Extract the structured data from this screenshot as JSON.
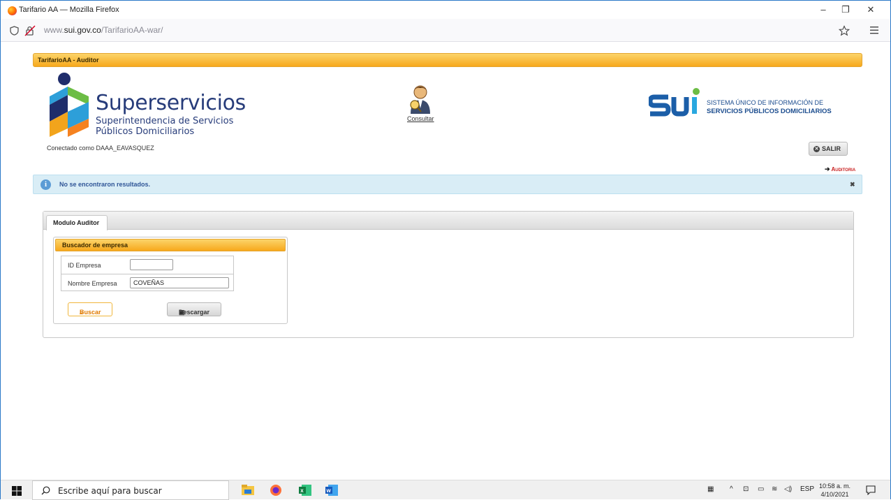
{
  "window": {
    "title": "Tarifario AA — Mozilla Firefox"
  },
  "browser": {
    "url_prefix": "www.",
    "url_domain": "sui.gov.co",
    "url_path": "/TarifarioAA-war/"
  },
  "app": {
    "bar_title": "TarifarioAA - Auditor",
    "logo": {
      "name": "Superservicios",
      "line1": "Superintendencia de Servicios",
      "line2": "Públicos Domiciliarios"
    },
    "consultar_label": "Consultar",
    "sui": {
      "line1": "SISTEMA ÚNICO DE INFORMACIÓN DE",
      "line2": "SERVICIOS PÚBLICOS DOMICILIARIOS"
    },
    "connected_as": "Conectado como DAAA_EAVASQUEZ",
    "logout_label": "SALIR",
    "auditoria_label": "Auditoria",
    "alert_message": "No se encontraron resultados.",
    "tab_label": "Modulo Auditor",
    "search_panel": {
      "title": "Buscador de empresa",
      "id_label": "ID Empresa",
      "id_value": "",
      "name_label": "Nombre Empresa",
      "name_value": "COVEÑAS",
      "buscar_label": "Buscar",
      "descargar_label": "Descargar"
    }
  },
  "taskbar": {
    "search_placeholder": "Escribe aquí para buscar",
    "lang": "ESP",
    "time": "10:58 a. m.",
    "date": "4/10/2021"
  }
}
